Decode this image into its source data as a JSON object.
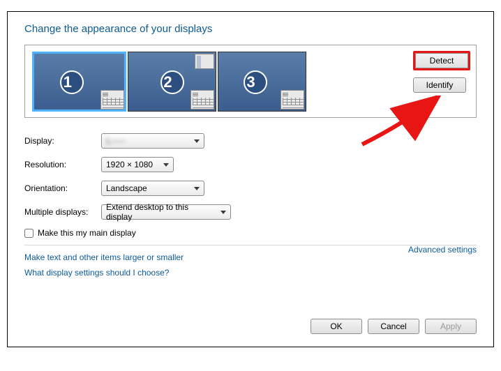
{
  "title": "Change the appearance of your displays",
  "monitors": [
    "1",
    "2",
    "3"
  ],
  "buttons": {
    "detect": "Detect",
    "identify": "Identify",
    "ok": "OK",
    "cancel": "Cancel",
    "apply": "Apply"
  },
  "labels": {
    "display": "Display:",
    "resolution": "Resolution:",
    "orientation": "Orientation:",
    "multiple": "Multiple displays:",
    "mainDisplay": "Make this my main display",
    "advanced": "Advanced settings"
  },
  "values": {
    "display": "L-----",
    "resolution": "1920 × 1080",
    "orientation": "Landscape",
    "multiple": "Extend desktop to this display"
  },
  "links": {
    "larger": "Make text and other items larger or smaller",
    "choose": "What display settings should I choose?"
  }
}
